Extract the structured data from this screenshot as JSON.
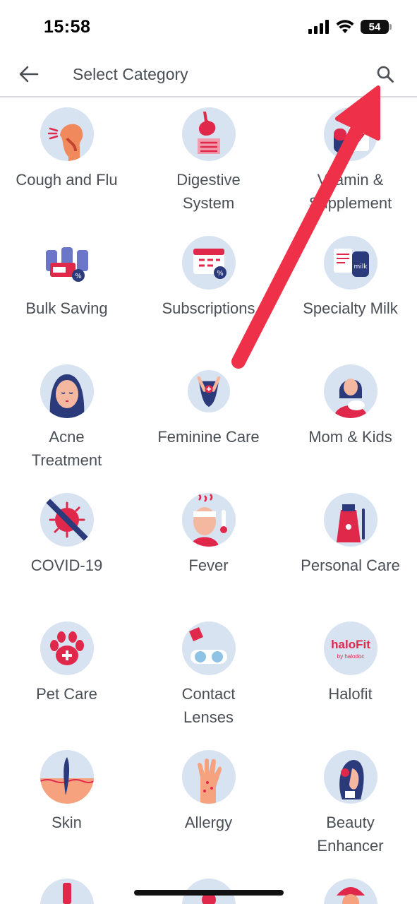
{
  "status_bar": {
    "time": "15:58",
    "battery": "54"
  },
  "header": {
    "title": "Select Category"
  },
  "categories": [
    {
      "label": "Cough and Flu"
    },
    {
      "label": "Digestive\nSystem"
    },
    {
      "label": "Vitamin &\nSupplement"
    },
    {
      "label": "Bulk Saving"
    },
    {
      "label": "Subscriptions"
    },
    {
      "label": "Specialty Milk"
    },
    {
      "label": "Acne\nTreatment"
    },
    {
      "label": "Feminine Care"
    },
    {
      "label": "Mom & Kids"
    },
    {
      "label": "COVID-19"
    },
    {
      "label": "Fever"
    },
    {
      "label": "Personal Care"
    },
    {
      "label": "Pet Care"
    },
    {
      "label": "Contact\nLenses"
    },
    {
      "label": "Halofit"
    },
    {
      "label": "Skin"
    },
    {
      "label": "Allergy"
    },
    {
      "label": "Beauty\nEnhancer"
    }
  ],
  "icons": {
    "back": "back-arrow-icon",
    "search": "search-icon"
  },
  "halofit_logo": {
    "brand": "haloFit",
    "byline": "by halodoc"
  },
  "colors": {
    "accent": "#e0284b",
    "circle_bg": "#d8e3f2",
    "annotation_arrow": "#ee3148"
  }
}
